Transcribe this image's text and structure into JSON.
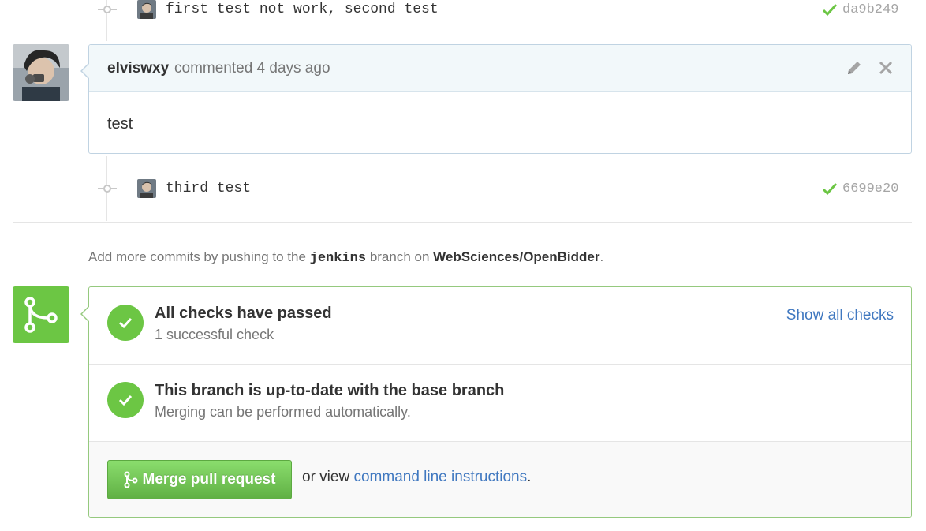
{
  "colors": {
    "success_green": "#6cc644",
    "link_blue": "#4078c0",
    "sha_gray": "#a5a5a5"
  },
  "commits": [
    {
      "message": "first test not work, second test",
      "sha": "da9b249",
      "status_icon": "check-icon"
    },
    {
      "message": "third test",
      "sha": "6699e20",
      "status_icon": "check-icon"
    }
  ],
  "comment": {
    "author": "elviswxy",
    "meta": "commented 4 days ago",
    "body": "test",
    "edit_icon": "pencil-icon",
    "delete_icon": "close-icon"
  },
  "push_hint": {
    "prefix": "Add more commits by pushing to the",
    "branch": "jenkins",
    "middle": "branch on",
    "repo": "WebSciences/OpenBidder",
    "suffix": "."
  },
  "merge": {
    "icon": "git-merge-icon",
    "checks": {
      "title": "All checks have passed",
      "subtitle": "1 successful check",
      "link": "Show all checks"
    },
    "branch_status": {
      "title": "This branch is up-to-date with the base branch",
      "subtitle": "Merging can be performed automatically."
    },
    "button_label": "Merge pull request",
    "alt_prefix": "or view",
    "alt_link": "command line instructions",
    "alt_suffix": "."
  }
}
